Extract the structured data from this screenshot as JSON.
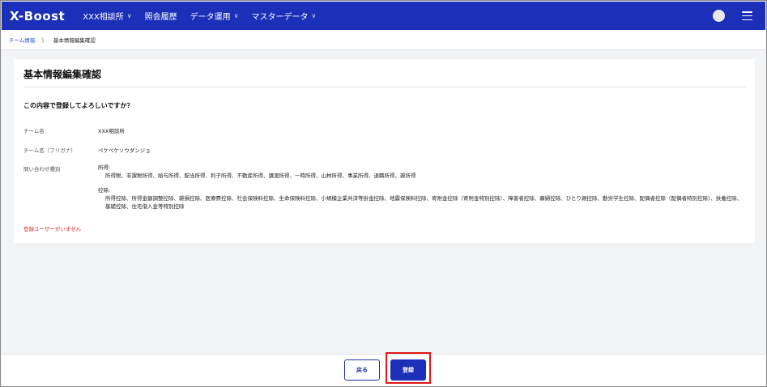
{
  "header": {
    "logo": "X-Boost",
    "nav": [
      {
        "label": "XXX相談所",
        "has_dropdown": true
      },
      {
        "label": "照会履歴",
        "has_dropdown": false
      },
      {
        "label": "データ運用",
        "has_dropdown": true
      },
      {
        "label": "マスターデータ",
        "has_dropdown": true
      }
    ],
    "chevron": "∨"
  },
  "breadcrumb": {
    "parent": "チーム情報",
    "separator": "〉",
    "current": "基本情報編集確認"
  },
  "card": {
    "title": "基本情報編集確認",
    "question": "この内容で登録してよろしいですか？",
    "rows": {
      "team_name": {
        "label": "チーム名",
        "value": "XXX相談所"
      },
      "team_kana": {
        "label": "チーム名（フリガナ）",
        "value": "ペケペケソウダンジョ"
      },
      "inquiry": {
        "label": "問い合わせ種別",
        "income_head": "所得:",
        "income_items": "所得税、非課税所得、給与所得、配当所得、利子所得、不動産所得、譲渡所得、一時所得、山林所得、事業所得、退職所得、雑所得",
        "deduction_head": "控除:",
        "deduction_items": "所得控除、所得金額調整控除、雑損控除、医療費控除、社会保険料控除、生命保険料控除、小規模企業共済等掛金控除、地震保険料控除、寄附金控除（寄附金特別控除）、障害者控除、寡婦控除、ひとり親控除、勤労学生控除、配偶者控除（配偶者特別控除）、扶養控除、基礎控除、住宅借入金等特別控除"
      }
    },
    "warning": "登録ユーザーがいません"
  },
  "footer": {
    "back_label": "戻る",
    "register_label": "登録"
  },
  "colors": {
    "brand": "#1c2fb8",
    "link": "#1f4fcf",
    "warning": "#d12b2b",
    "highlight": "#e01818"
  }
}
